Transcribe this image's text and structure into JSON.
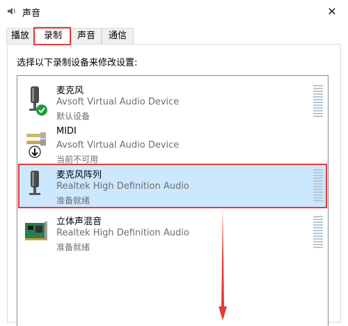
{
  "window": {
    "title": "声音"
  },
  "tabs": [
    {
      "label": "播放"
    },
    {
      "label": "录制"
    },
    {
      "label": "声音"
    },
    {
      "label": "通信"
    }
  ],
  "instruction": "选择以下录制设备来修改设置:",
  "devices": [
    {
      "name": "麦克风",
      "driver": "Avsoft Virtual Audio Device",
      "status": "默认设备",
      "icon": "microphone-default-icon"
    },
    {
      "name": "MIDI",
      "driver": "Avsoft Virtual Audio Device",
      "status": "当前不可用",
      "icon": "midi-jack-icon"
    },
    {
      "name": "麦克风阵列",
      "driver": "Realtek High Definition Audio",
      "status": "准备就绪",
      "icon": "microphone-icon"
    },
    {
      "name": "立体声混音",
      "driver": "Realtek High Definition Audio",
      "status": "准备就绪",
      "icon": "sound-card-icon"
    }
  ],
  "colors": {
    "selection": "#cce8ff",
    "highlight": "#e53935",
    "meter": "#b7c7d3"
  }
}
